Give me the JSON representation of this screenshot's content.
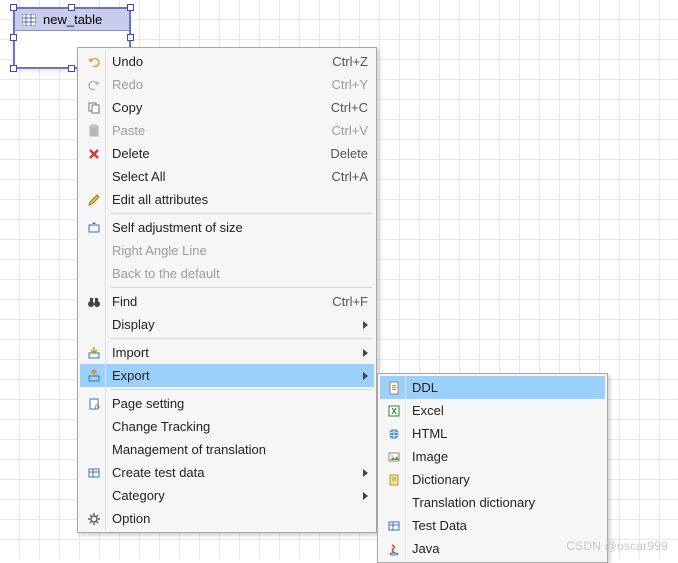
{
  "entity": {
    "name": "new_table"
  },
  "main_menu": {
    "items": [
      {
        "label": "Undo",
        "shortcut": "Ctrl+Z",
        "icon": "undo-icon",
        "disabled": false
      },
      {
        "label": "Redo",
        "shortcut": "Ctrl+Y",
        "icon": "redo-icon",
        "disabled": true
      },
      {
        "label": "Copy",
        "shortcut": "Ctrl+C",
        "icon": "copy-icon",
        "disabled": false
      },
      {
        "label": "Paste",
        "shortcut": "Ctrl+V",
        "icon": "paste-icon",
        "disabled": true
      },
      {
        "label": "Delete",
        "shortcut": "Delete",
        "icon": "delete-icon",
        "disabled": false
      },
      {
        "label": "Select All",
        "shortcut": "Ctrl+A",
        "icon": "",
        "disabled": false
      },
      {
        "label": "Edit all attributes",
        "shortcut": "",
        "icon": "pencil-icon",
        "disabled": false
      },
      {
        "sep": true
      },
      {
        "label": "Self adjustment of size",
        "shortcut": "",
        "icon": "resize-icon",
        "disabled": false
      },
      {
        "label": "Right Angle Line",
        "shortcut": "",
        "icon": "",
        "disabled": true
      },
      {
        "label": "Back to the default",
        "shortcut": "",
        "icon": "",
        "disabled": true
      },
      {
        "sep": true
      },
      {
        "label": "Find",
        "shortcut": "Ctrl+F",
        "icon": "binoculars-icon",
        "disabled": false
      },
      {
        "label": "Display",
        "shortcut": "",
        "icon": "",
        "submenu": true,
        "disabled": false
      },
      {
        "sep": true
      },
      {
        "label": "Import",
        "shortcut": "",
        "icon": "import-icon",
        "submenu": true,
        "disabled": false
      },
      {
        "label": "Export",
        "shortcut": "",
        "icon": "export-icon",
        "submenu": true,
        "disabled": false,
        "highlight": true
      },
      {
        "sep": true
      },
      {
        "label": "Page setting",
        "shortcut": "",
        "icon": "page-setup-icon",
        "disabled": false
      },
      {
        "label": "Change Tracking",
        "shortcut": "",
        "icon": "",
        "disabled": false
      },
      {
        "label": "Management of translation",
        "shortcut": "",
        "icon": "",
        "disabled": false
      },
      {
        "label": "Create test data",
        "shortcut": "",
        "icon": "test-data-icon",
        "submenu": true,
        "disabled": false
      },
      {
        "label": "Category",
        "shortcut": "",
        "icon": "",
        "submenu": true,
        "disabled": false
      },
      {
        "label": "Option",
        "shortcut": "",
        "icon": "gear-icon",
        "disabled": false
      }
    ]
  },
  "sub_menu": {
    "items": [
      {
        "label": "DDL",
        "icon": "ddl-icon",
        "highlight": true
      },
      {
        "label": "Excel",
        "icon": "excel-icon"
      },
      {
        "label": "HTML",
        "icon": "html-icon"
      },
      {
        "label": "Image",
        "icon": "image-icon"
      },
      {
        "label": "Dictionary",
        "icon": "dictionary-icon"
      },
      {
        "label": "Translation dictionary",
        "icon": ""
      },
      {
        "label": "Test Data",
        "icon": "test-data-icon"
      },
      {
        "label": "Java",
        "icon": "java-icon"
      }
    ]
  },
  "watermark": "CSDN @oscar999"
}
